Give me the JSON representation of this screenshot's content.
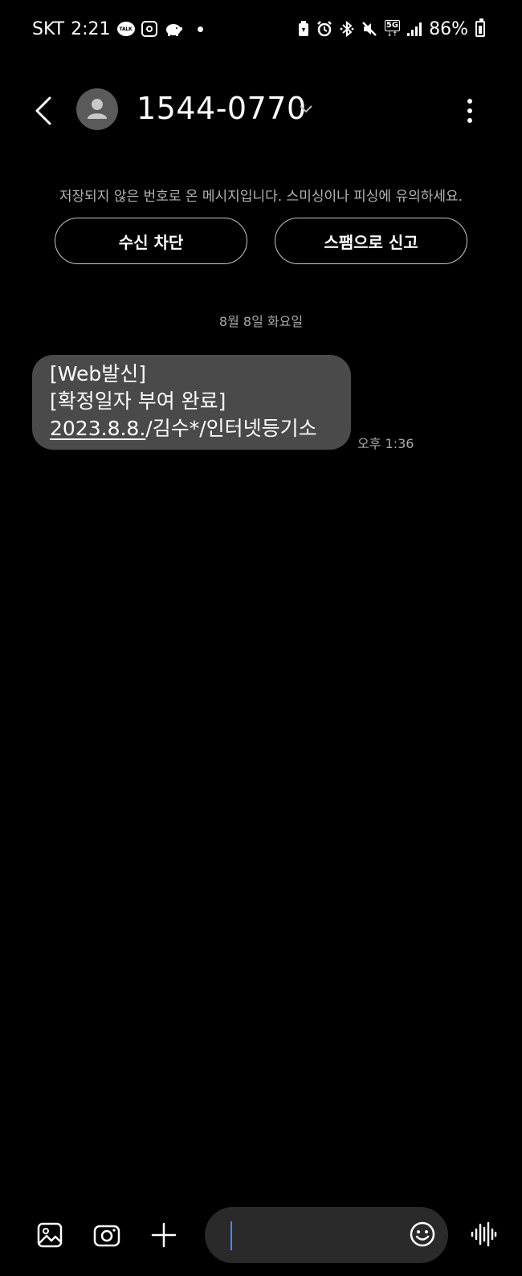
{
  "status_bar": {
    "carrier": "SKT",
    "time": "2:21",
    "talk_badge": "TALK",
    "network_badge": "5G",
    "battery_percent": "86%",
    "icons_left": [
      "kakaotalk-icon",
      "instagram-icon",
      "piggy-bank-icon",
      "notification-dot"
    ],
    "icons_right": [
      "battery-saver-icon",
      "alarm-icon",
      "bluetooth-icon",
      "mute-icon",
      "5g-icon",
      "signal-icon",
      "battery-icon"
    ]
  },
  "header": {
    "contact_name": "1544-0770"
  },
  "notice": {
    "text": "저장되지 않은 번호로 온 메시지입니다. 스미싱이나 피싱에 유의하세요."
  },
  "actions": {
    "block_label": "수신 차단",
    "spam_label": "스팸으로 신고"
  },
  "conversation": {
    "date_separator": "8월 8일 화요일",
    "messages": [
      {
        "line1": "[Web발신]",
        "line2": "[확정일자 부여 완료]",
        "link_text": "2023.8.8.",
        "line3_rest": "/김수*/인터넷등기소",
        "time": "오후 1:36"
      }
    ]
  },
  "composer": {
    "placeholder": ""
  },
  "colors": {
    "background": "#000000",
    "bubble": "#4a4a4a",
    "cursor": "#3e8ef7",
    "input": "#2a2a2a"
  }
}
